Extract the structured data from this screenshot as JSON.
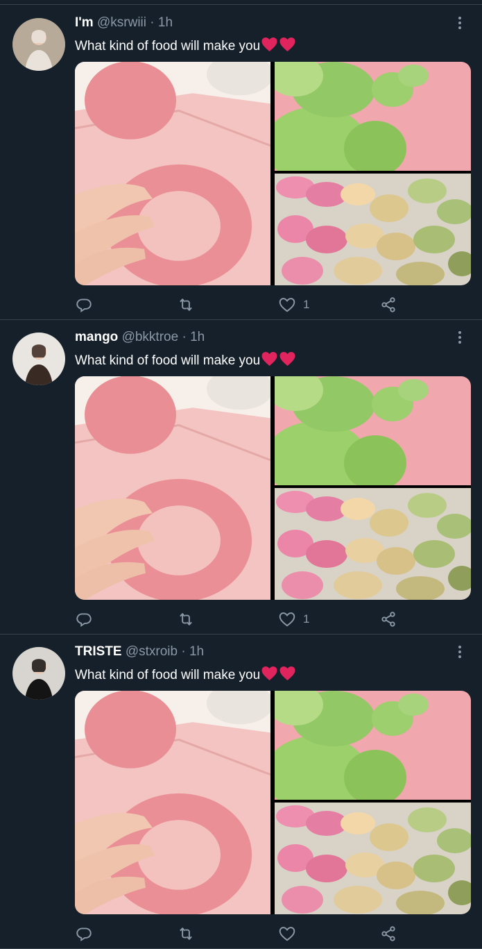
{
  "tweets": [
    {
      "name": "I'm",
      "handle": "@ksrwiii",
      "separator": "·",
      "time": "1h",
      "text": "What kind of food will make you",
      "emoji": "red-heart-icon x2",
      "like_count": "1",
      "avatar_colors": {
        "bg": "#b7aa98",
        "figure": "#e8e2da"
      }
    },
    {
      "name": "mango",
      "handle": "@bkktroe",
      "separator": "·",
      "time": "1h",
      "text": "What kind of food will make you",
      "emoji": "red-heart-icon x2",
      "like_count": "1",
      "avatar_colors": {
        "bg": "#e9e6e2",
        "figure": "#3a2a24"
      }
    },
    {
      "name": "TRISTE",
      "handle": "@stxroib",
      "separator": "·",
      "time": "1h",
      "text": "What kind of food will make you",
      "emoji": "red-heart-icon x2",
      "like_count": "",
      "avatar_colors": {
        "bg": "#d8d4cf",
        "figure": "#141414"
      }
    }
  ],
  "icons": {
    "reply": "reply-icon",
    "retweet": "retweet-icon",
    "like": "heart-outline-icon",
    "share": "share-icon",
    "more": "more-vertical-icon"
  },
  "colors": {
    "background": "#15202b",
    "divider": "#38444d",
    "secondary_text": "#8b98a5",
    "heart_emoji": "#e0245e",
    "dough_pink": "#e89a9c",
    "dumpling_green": "#8cc25a"
  }
}
